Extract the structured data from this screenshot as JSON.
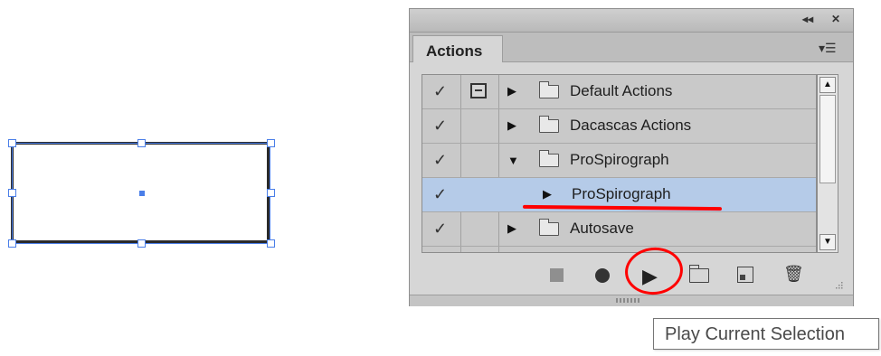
{
  "panel": {
    "title_buttons": {
      "collapse": "◂◂",
      "close": "✕"
    },
    "tab_label": "Actions",
    "menu_icon": "panel-menu-icon",
    "rows": [
      {
        "checked": "✓",
        "expanded": false,
        "label": "Default Actions",
        "type": "set",
        "dialog_toggle": true
      },
      {
        "checked": "✓",
        "expanded": false,
        "label": "Dacascas Actions",
        "type": "set",
        "dialog_toggle": false
      },
      {
        "checked": "✓",
        "expanded": true,
        "label": "ProSpirograph",
        "type": "set",
        "dialog_toggle": false
      },
      {
        "checked": "✓",
        "expanded": false,
        "label": "ProSpirograph",
        "type": "action",
        "selected": true,
        "dialog_toggle": false
      },
      {
        "checked": "✓",
        "expanded": false,
        "label": "Autosave",
        "type": "set",
        "dialog_toggle": false
      }
    ],
    "toolbar": {
      "stop": "stop-icon",
      "record": "record-icon",
      "play": "▶",
      "new_set": "folder-icon",
      "new_action": "new-action-icon",
      "delete": "🗑"
    }
  },
  "tooltip": {
    "text": "Play Current Selection"
  },
  "colors": {
    "selection": "#b5cbe8",
    "annotation": "#ff0000",
    "bbox": "#4a7ee8"
  }
}
